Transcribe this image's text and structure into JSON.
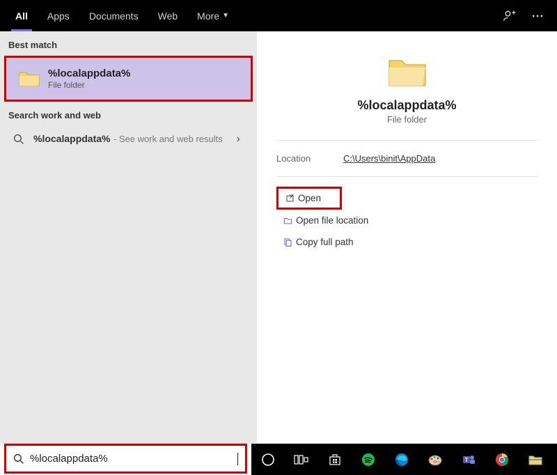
{
  "tabs": [
    "All",
    "Apps",
    "Documents",
    "Web",
    "More"
  ],
  "sections": {
    "best_match": "Best match",
    "search_work_web": "Search work and web"
  },
  "best_match": {
    "title": "%localappdata%",
    "subtitle": "File folder"
  },
  "web_result": {
    "query": "%localappdata%",
    "desc": "See work and web results"
  },
  "preview": {
    "title": "%localappdata%",
    "subtitle": "File folder",
    "location_label": "Location",
    "location_value": "C:\\Users\\binit\\AppData"
  },
  "actions": {
    "open": "Open",
    "open_file_location": "Open file location",
    "copy_full_path": "Copy full path"
  },
  "search_input": {
    "value": "%localappdata%"
  }
}
